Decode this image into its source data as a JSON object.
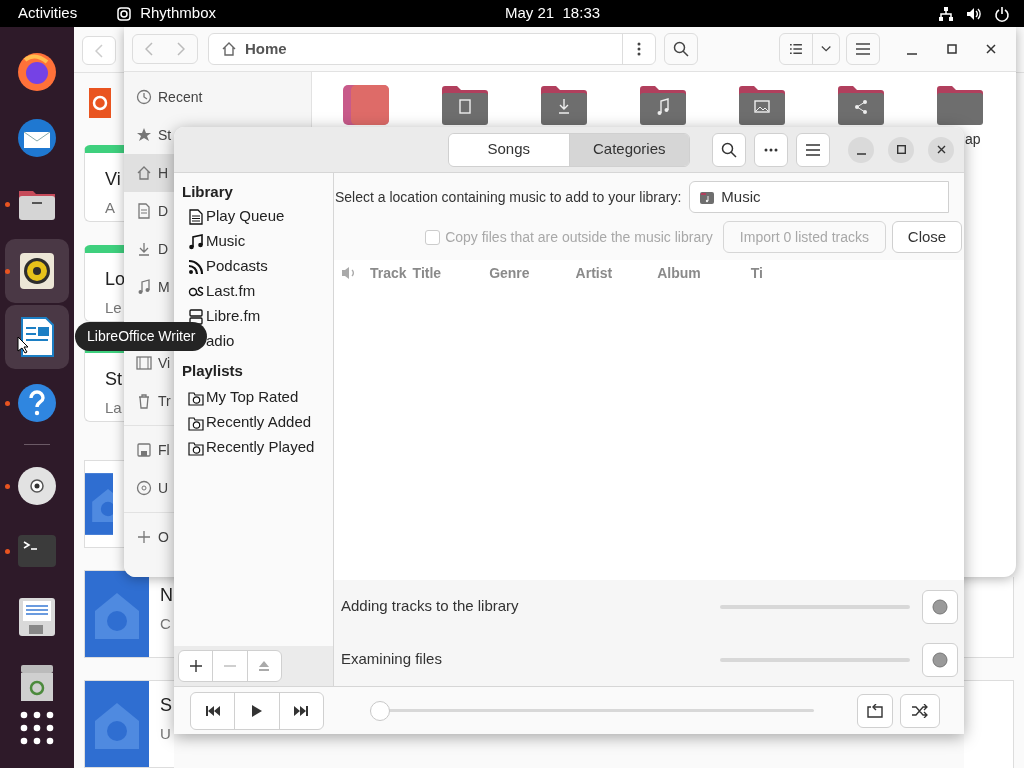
{
  "top_bar": {
    "activities": "Activities",
    "app_name": "Rhythmbox",
    "clock": "May 21  18:33"
  },
  "dock": {
    "items": [
      {
        "running": false,
        "focused": false
      },
      {
        "running": false,
        "focused": false
      },
      {
        "running": true,
        "focused": false
      },
      {
        "running": true,
        "focused": true
      },
      {
        "running": false,
        "focused": true
      },
      {
        "running": true,
        "focused": false
      },
      {
        "running": true,
        "focused": false
      },
      {
        "running": true,
        "focused": false
      },
      {
        "running": false,
        "focused": false
      },
      {
        "running": false,
        "focused": false
      },
      {
        "running": false,
        "focused": false
      }
    ]
  },
  "tooltip": "LibreOffice Writer",
  "background_window": {
    "cards": [
      {
        "kind": "accent",
        "title": "Vi",
        "subtitle": "A"
      },
      {
        "kind": "accent",
        "title": "Lo",
        "subtitle": "Le"
      },
      {
        "kind": "accent",
        "title": "St",
        "subtitle": "La"
      },
      {
        "kind": "icon"
      },
      {
        "kind": "icon",
        "title": "N",
        "subtitle": "C"
      },
      {
        "kind": "icon",
        "title": "S",
        "subtitle": "U"
      }
    ]
  },
  "files_window": {
    "path": "Home",
    "sidebar": [
      {
        "label": "Recent",
        "selected": false
      },
      {
        "label": "St",
        "selected": false
      },
      {
        "label": "H",
        "selected": true
      },
      {
        "label": "D",
        "selected": false
      },
      {
        "label": "D",
        "selected": false
      },
      {
        "label": "M",
        "selected": false
      },
      {
        "label": "Vi",
        "selected": false
      },
      {
        "label": "Tr",
        "selected": false
      },
      {
        "label": "Fl",
        "selected": false
      },
      {
        "label": "U",
        "selected": false
      },
      {
        "label": "O",
        "selected": false
      }
    ],
    "folder_label": "ap"
  },
  "rhythmbox": {
    "tabs": [
      {
        "label": "Songs",
        "selected": false
      },
      {
        "label": "Categories",
        "selected": true
      }
    ],
    "library_heading": "Library",
    "library": [
      {
        "label": "Play Queue"
      },
      {
        "label": "Music"
      },
      {
        "label": "Podcasts"
      },
      {
        "label": "Last.fm"
      },
      {
        "label": "Libre.fm"
      },
      {
        "label": "adio"
      }
    ],
    "playlists_heading": "Playlists",
    "playlists": [
      {
        "label": "My Top Rated"
      },
      {
        "label": "Recently Added"
      },
      {
        "label": "Recently Played"
      }
    ],
    "import": {
      "prompt": "Select a location containing music to add to your library:",
      "location": "Music",
      "copy_files": {
        "label": "Copy files that are outside the music library",
        "checked": false,
        "disabled": true
      },
      "import_button": {
        "label": "Import 0 listed tracks",
        "disabled": true
      },
      "close_button": "Close"
    },
    "columns": [
      "Track",
      "Title",
      "Genre",
      "Artist",
      "Album",
      "Ti"
    ],
    "progress": [
      {
        "label": "Adding tracks to the library"
      },
      {
        "label": "Examining files"
      }
    ],
    "player": {
      "position": {
        "level": 0
      }
    }
  }
}
